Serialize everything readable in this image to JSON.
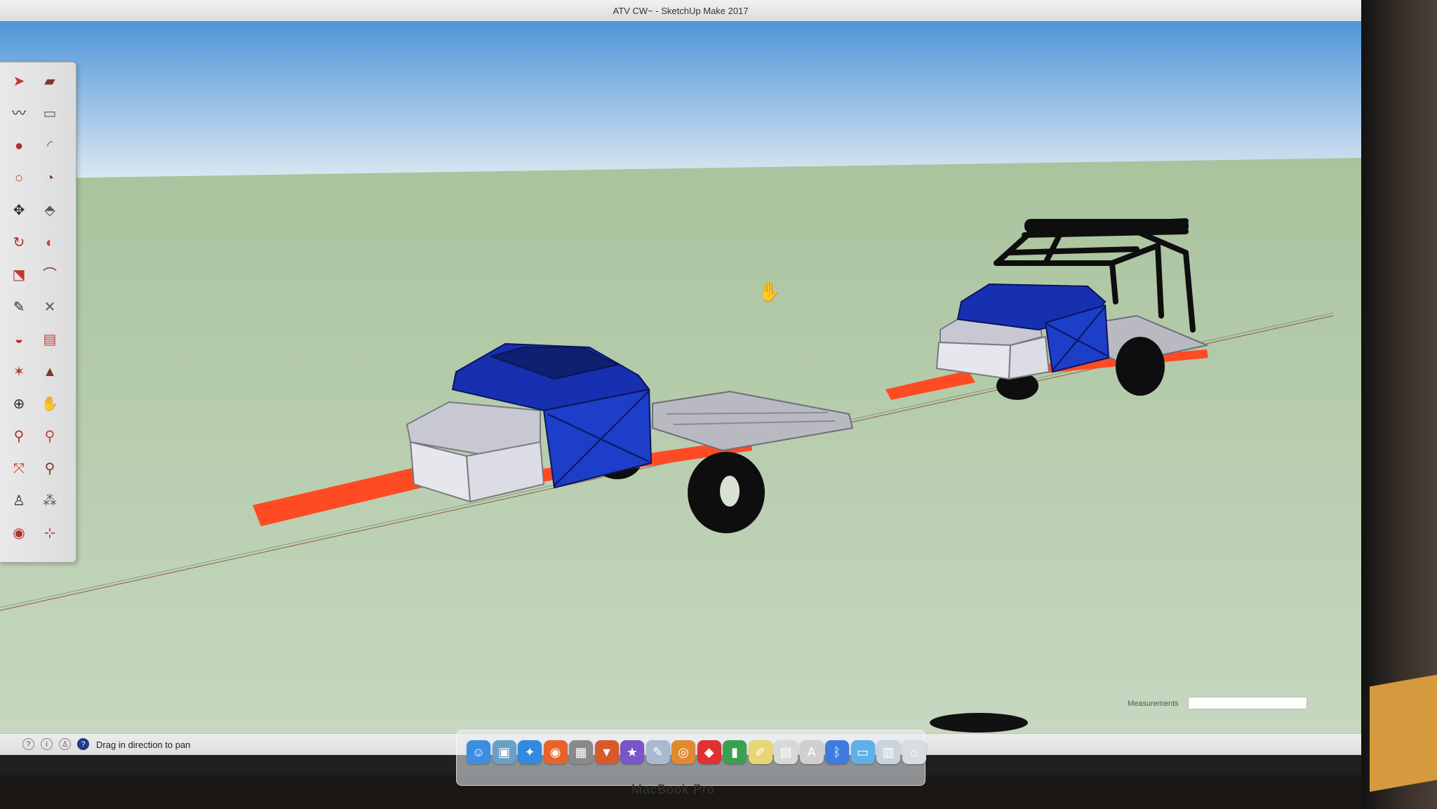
{
  "window": {
    "title": "ATV CW~ - SketchUp Make 2017"
  },
  "toolbar": {
    "tools": [
      {
        "name": "select-tool",
        "icon": "arrow-icon",
        "glyph": "➤"
      },
      {
        "name": "eraser-tool",
        "icon": "eraser-icon",
        "glyph": "▰"
      },
      {
        "name": "freehand-tool",
        "icon": "squiggle-icon",
        "glyph": "〰"
      },
      {
        "name": "rectangle-tool",
        "icon": "rectangle-icon",
        "glyph": "▭"
      },
      {
        "name": "paint-bucket-tool",
        "icon": "paint-bucket-icon",
        "glyph": "●"
      },
      {
        "name": "arc-tool",
        "icon": "arc-icon",
        "glyph": "◜"
      },
      {
        "name": "circle-tool",
        "icon": "circle-icon",
        "glyph": "○"
      },
      {
        "name": "pie-tool",
        "icon": "pie-icon",
        "glyph": "◔"
      },
      {
        "name": "move-tool",
        "icon": "move-icon",
        "glyph": "✥"
      },
      {
        "name": "push-pull-tool",
        "icon": "push-pull-icon",
        "glyph": "⬘"
      },
      {
        "name": "rotate-tool",
        "icon": "rotate-icon",
        "glyph": "↻"
      },
      {
        "name": "follow-me-tool",
        "icon": "follow-me-icon",
        "glyph": "◐"
      },
      {
        "name": "scale-tool",
        "icon": "scale-icon",
        "glyph": "⬔"
      },
      {
        "name": "offset-tool",
        "icon": "offset-icon",
        "glyph": "⌒"
      },
      {
        "name": "tape-measure-tool",
        "icon": "tape-measure-icon",
        "glyph": "✎"
      },
      {
        "name": "dimension-tool",
        "icon": "dimension-icon",
        "glyph": "✕"
      },
      {
        "name": "protractor-tool",
        "icon": "protractor-icon",
        "glyph": "◒"
      },
      {
        "name": "text-tool",
        "icon": "text-icon",
        "glyph": "▤"
      },
      {
        "name": "axes-tool",
        "icon": "axes-icon",
        "glyph": "✶"
      },
      {
        "name": "3d-text-tool",
        "icon": "3d-text-icon",
        "glyph": "▲"
      },
      {
        "name": "orbit-tool",
        "icon": "orbit-icon",
        "glyph": "⊕"
      },
      {
        "name": "pan-tool",
        "icon": "pan-hand-icon",
        "glyph": "✋"
      },
      {
        "name": "zoom-tool",
        "icon": "zoom-icon",
        "glyph": "⚲"
      },
      {
        "name": "zoom-window-tool",
        "icon": "zoom-window-icon",
        "glyph": "⚲"
      },
      {
        "name": "zoom-extents-tool",
        "icon": "zoom-extents-icon",
        "glyph": "⤧"
      },
      {
        "name": "previous-view-tool",
        "icon": "previous-view-icon",
        "glyph": "⚲"
      },
      {
        "name": "position-camera-tool",
        "icon": "position-camera-icon",
        "glyph": "♙"
      },
      {
        "name": "walk-tool",
        "icon": "footprints-icon",
        "glyph": "⁂"
      },
      {
        "name": "look-around-tool",
        "icon": "eye-icon",
        "glyph": "◉"
      },
      {
        "name": "section-plane-tool",
        "icon": "section-plane-icon",
        "glyph": "⊹"
      }
    ]
  },
  "measurements": {
    "label": "Measurements",
    "value": ""
  },
  "status": {
    "text": "Drag in direction to pan",
    "icons": [
      "geo-location-icon",
      "info-icon",
      "user-icon",
      "instructor-icon"
    ]
  },
  "dock": {
    "apps": [
      {
        "name": "finder",
        "icon": "finder-icon",
        "color": "#3a8fe0",
        "glyph": "☺"
      },
      {
        "name": "preview",
        "icon": "preview-icon",
        "color": "#6aa0c8",
        "glyph": "▣"
      },
      {
        "name": "safari",
        "icon": "safari-compass-icon",
        "color": "#2f8ae0",
        "glyph": "✦"
      },
      {
        "name": "firefox",
        "icon": "firefox-icon",
        "color": "#e8622a",
        "glyph": "◉"
      },
      {
        "name": "photo-browser",
        "icon": "photos-icon",
        "color": "#8a8a8a",
        "glyph": "▦"
      },
      {
        "name": "keynote",
        "icon": "keynote-icon",
        "color": "#d65a2a",
        "glyph": "▼"
      },
      {
        "name": "imovie",
        "icon": "imovie-star-icon",
        "color": "#7a54c9",
        "glyph": "★"
      },
      {
        "name": "sketchbook",
        "icon": "pencil-icon",
        "color": "#a8b9d0",
        "glyph": "✎"
      },
      {
        "name": "blender",
        "icon": "blender-icon",
        "color": "#e08a30",
        "glyph": "◎"
      },
      {
        "name": "sketchup",
        "icon": "sketchup-icon",
        "color": "#e03030",
        "glyph": "◆"
      },
      {
        "name": "numbers",
        "icon": "numbers-chart-icon",
        "color": "#3aa050",
        "glyph": "▮"
      },
      {
        "name": "notes",
        "icon": "notes-icon",
        "color": "#e8d670",
        "glyph": "✐"
      },
      {
        "name": "textedit",
        "icon": "textedit-icon",
        "color": "#d8d8d8",
        "glyph": "▤"
      },
      {
        "name": "font-book",
        "icon": "font-book-icon",
        "color": "#cfcfcf",
        "glyph": "A"
      },
      {
        "name": "bluetooth",
        "icon": "bluetooth-icon",
        "color": "#3e7be0",
        "glyph": "ᛒ"
      },
      {
        "name": "applications-folder",
        "icon": "folder-icon",
        "color": "#5fb0e8",
        "glyph": "▭"
      },
      {
        "name": "downloads-stack",
        "icon": "stack-icon",
        "color": "#c9d4de",
        "glyph": "▥"
      },
      {
        "name": "trash",
        "icon": "trash-icon",
        "color": "#d9dde1",
        "glyph": "⌂"
      }
    ]
  },
  "colors": {
    "sky_top": "#4f96d9",
    "sky_bottom": "#dfe9f2",
    "ground": "#b4ccaa",
    "frame_red": "#ff4b23",
    "body_blue": "#1d3ec8",
    "body_white": "#dcdce4",
    "tire_black": "#0e0e0e"
  }
}
